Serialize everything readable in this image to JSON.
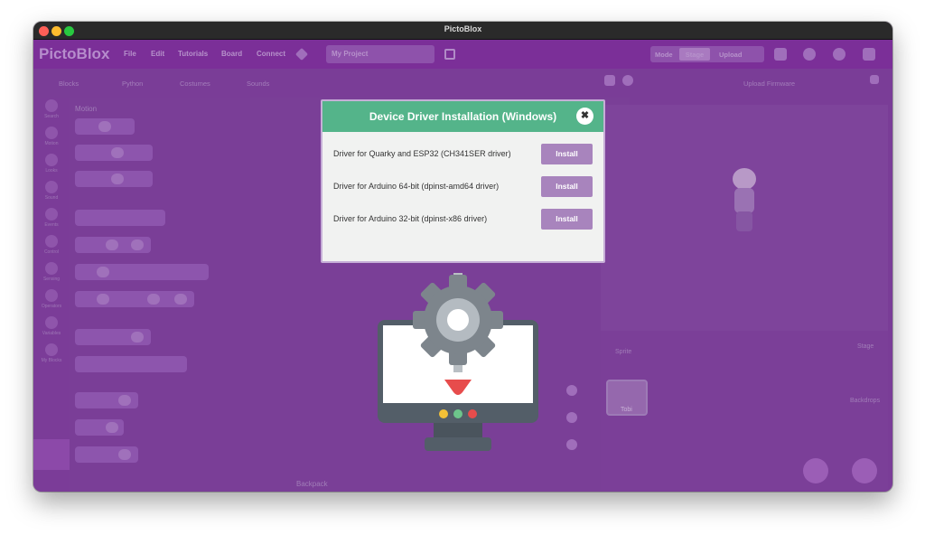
{
  "window": {
    "title": "PictoBlox"
  },
  "menubar": {
    "logo": "PictoBlox",
    "items": [
      "File",
      "Edit",
      "Tutorials",
      "Board",
      "Connect"
    ],
    "project_name": "My Project",
    "mode_label": "Mode",
    "mode_options": [
      "Stage",
      "Upload"
    ]
  },
  "subbar": {
    "tabs": [
      "Blocks",
      "Python",
      "Costumes",
      "Sounds"
    ],
    "upload_firmware": "Upload Firmware"
  },
  "palette": {
    "categories": [
      "Search",
      "Motion",
      "Looks",
      "Sound",
      "Events",
      "Control",
      "Sensing",
      "Operators",
      "Variables",
      "My Blocks"
    ],
    "section_title": "Motion"
  },
  "canvas": {
    "backpack": "Backpack"
  },
  "dialog": {
    "title": "Device Driver Installation (Windows)",
    "close_symbol": "✖",
    "drivers": [
      {
        "label": "Driver for Quarky and ESP32 (CH341SER driver)",
        "button": "Install"
      },
      {
        "label": "Driver for Arduino 64-bit (dpinst-amd64 driver)",
        "button": "Install"
      },
      {
        "label": "Driver for Arduino 32-bit (dpinst-x86 driver)",
        "button": "Install"
      }
    ]
  },
  "sprite_panel": {
    "sprite_label": "Sprite",
    "sprite_name": "Tobi",
    "stage_label": "Stage",
    "backdrops_label": "Backdrops"
  },
  "colors": {
    "overlay": "#7a3d97",
    "dialog_header": "#54b48a",
    "install_button": "#a884bd",
    "gear": "#7d858c",
    "arrow": "#e74c4c"
  }
}
